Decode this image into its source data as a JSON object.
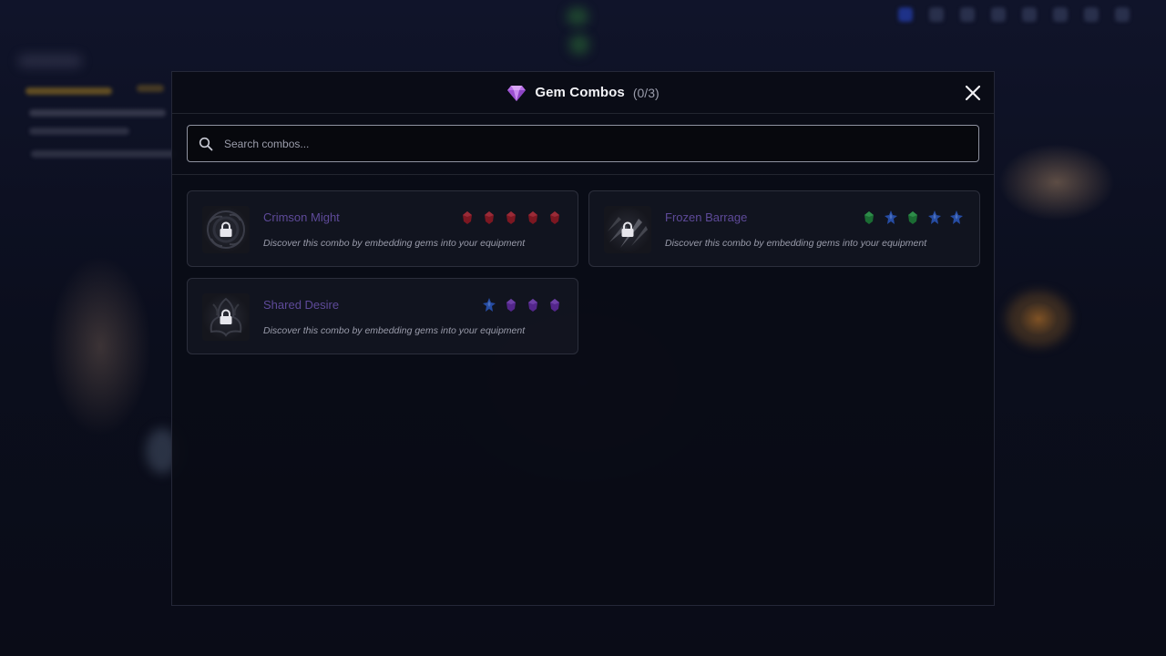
{
  "modal": {
    "title": "Gem Combos",
    "count": "(0/3)"
  },
  "search": {
    "placeholder": "Search combos..."
  },
  "combos": [
    {
      "name": "Crimson Might",
      "description": "Discover this combo by embedding gems into your equipment",
      "locked": true,
      "gems": [
        "red",
        "red",
        "red",
        "red",
        "red"
      ]
    },
    {
      "name": "Frozen Barrage",
      "description": "Discover this combo by embedding gems into your equipment",
      "locked": true,
      "gems": [
        "green",
        "blue",
        "green",
        "blue",
        "blue"
      ]
    },
    {
      "name": "Shared Desire",
      "description": "Discover this combo by embedding gems into your equipment",
      "locked": true,
      "gems": [
        "blue",
        "purple",
        "purple",
        "purple"
      ]
    }
  ],
  "colors": {
    "combo_name": "#5e4a99",
    "gem_red": "#a01822",
    "gem_green": "#1f8a3a",
    "gem_blue": "#2d5fd0",
    "gem_purple": "#6a2cb0",
    "title_gem": "#c88bf0"
  }
}
